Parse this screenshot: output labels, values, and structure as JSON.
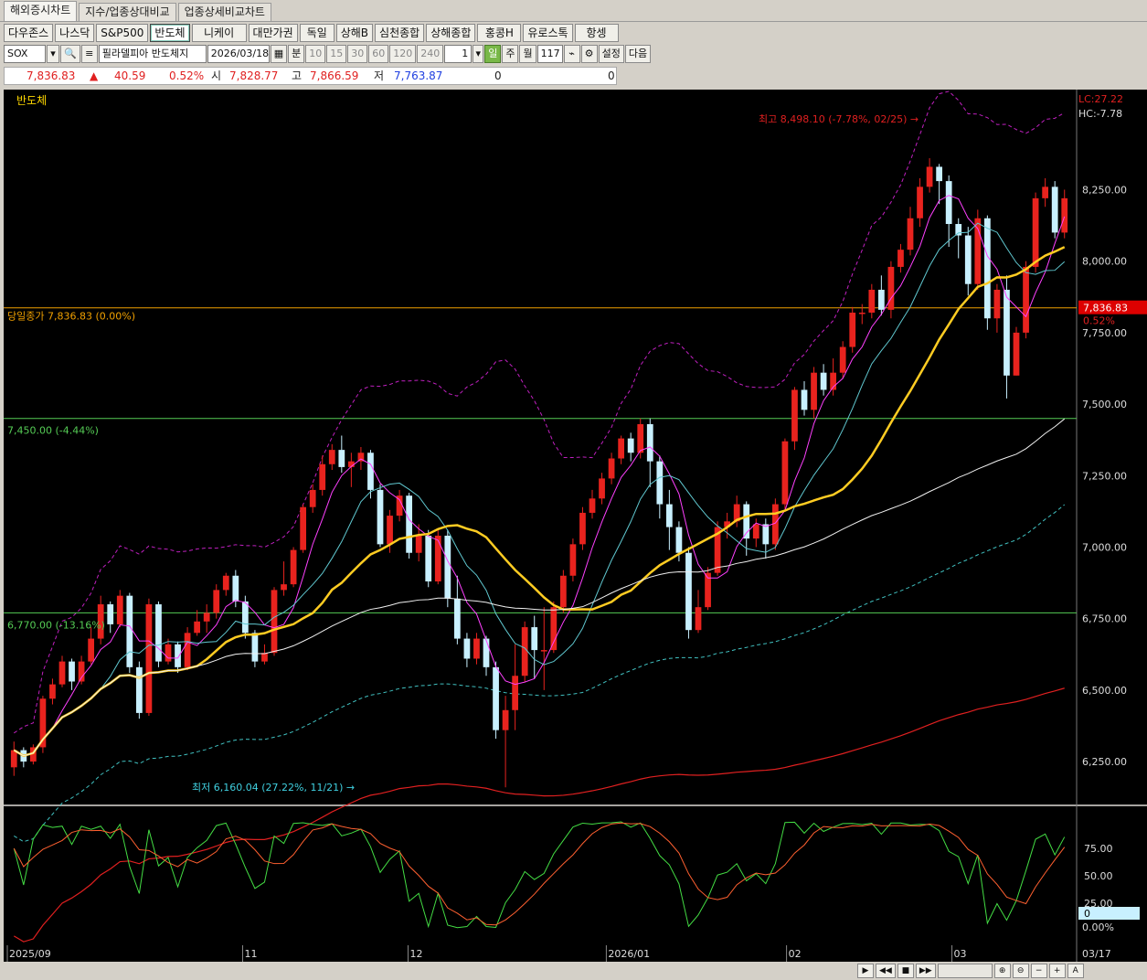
{
  "tabs": [
    "해외증시차트",
    "지수/업종상대비교",
    "업종상세비교차트"
  ],
  "markets": [
    "다우존스",
    "나스닥",
    "S&P500",
    "반도체",
    "니케이",
    "대만가권",
    "독일",
    "상해B",
    "심천종합",
    "상해종합",
    "홍콩H",
    "유로스톡",
    "항셍"
  ],
  "active_market": "반도체",
  "controls": {
    "symbol": "SOX",
    "name_label": "필라델피아 반도체지",
    "date": "2026/03/18",
    "minute_label": "분",
    "intervals": [
      "10",
      "15",
      "30",
      "60",
      "120",
      "240"
    ],
    "count": "1",
    "day": "일",
    "week": "주",
    "month": "월",
    "bars": "117",
    "settings": "설정",
    "next": "다음"
  },
  "price": {
    "last": "7,836.83",
    "change": "40.59",
    "change_pct": "0.52%",
    "open_label": "시",
    "open": "7,828.77",
    "high_label": "고",
    "high": "7,866.59",
    "low_label": "저",
    "low": "7,763.87",
    "vol1": "0",
    "vol2": "0"
  },
  "chart": {
    "title": "반도체",
    "lc_label": "LC:27.22",
    "hc_label": "HC:-7.78",
    "current_price_tag": "7,836.83",
    "current_pct_tag": "0.52%",
    "close_line_label": "당일종가 7,836.83 (0.00%)",
    "hline1_label": "7,450.00 (-4.44%)",
    "hline2_label": "6,770.00 (-13.16%)",
    "high_annotation": "최고 8,498.10 (-7.78%, 02/25)",
    "low_annotation": "최저 6,160.04 (27.22%, 11/21)",
    "y_ticks": [
      "8,250.00",
      "8,000.00",
      "7,750.00",
      "7,500.00",
      "7,250.00",
      "7,000.00",
      "6,750.00",
      "6,500.00",
      "6,250.00"
    ],
    "osc_ticks": [
      "75.00",
      "50.00",
      "25.00"
    ],
    "osc_value": "0",
    "osc_pct": "0.00%",
    "x_labels": [
      "2025/09",
      "11",
      "12",
      "2026/01",
      "02",
      "03"
    ],
    "x_right_label": "03/17",
    "colors": {
      "up": "#e8231e",
      "down": "#c8f0ff",
      "ma5": "#ff40ff",
      "ma10": "#60c8d0",
      "ma20": "#ffcc22",
      "ma60": "#f0f0f0",
      "ma120": "#e02020",
      "envelope": "#c020c0",
      "band": "#40c0c0",
      "hline": "#55cc55",
      "closeline": "#f0a000"
    }
  },
  "chart_data": {
    "type": "candlestick",
    "title": "반도체",
    "ylim": [
      6100,
      8600
    ],
    "y_ticks": [
      6250,
      6500,
      6750,
      7000,
      7250,
      7500,
      7750,
      8000,
      8250
    ],
    "x_labels": [
      "2025/09",
      "11",
      "12",
      "2026/01",
      "02",
      "03",
      "03/17"
    ],
    "high": {
      "value": 8498.1,
      "date": "02/25"
    },
    "low": {
      "value": 6160.04,
      "date": "11/21"
    },
    "reference_lines": [
      7836.83,
      7450.0,
      6770.0
    ],
    "candles": [
      [
        6230,
        6290,
        6200,
        6320
      ],
      [
        6290,
        6250,
        6230,
        6300
      ],
      [
        6250,
        6300,
        6240,
        6310
      ],
      [
        6300,
        6470,
        6280,
        6480
      ],
      [
        6470,
        6520,
        6450,
        6540
      ],
      [
        6520,
        6600,
        6510,
        6620
      ],
      [
        6600,
        6530,
        6500,
        6610
      ],
      [
        6530,
        6600,
        6520,
        6620
      ],
      [
        6600,
        6680,
        6590,
        6720
      ],
      [
        6680,
        6800,
        6660,
        6830
      ],
      [
        6800,
        6730,
        6700,
        6810
      ],
      [
        6730,
        6830,
        6720,
        6850
      ],
      [
        6830,
        6580,
        6560,
        6840
      ],
      [
        6580,
        6420,
        6400,
        6600
      ],
      [
        6420,
        6800,
        6410,
        6820
      ],
      [
        6800,
        6600,
        6580,
        6810
      ],
      [
        6600,
        6660,
        6590,
        6680
      ],
      [
        6660,
        6580,
        6560,
        6670
      ],
      [
        6580,
        6700,
        6570,
        6720
      ],
      [
        6700,
        6740,
        6690,
        6780
      ],
      [
        6740,
        6770,
        6700,
        6800
      ],
      [
        6770,
        6850,
        6750,
        6870
      ],
      [
        6850,
        6900,
        6830,
        6910
      ],
      [
        6900,
        6810,
        6790,
        6920
      ],
      [
        6810,
        6700,
        6680,
        6830
      ],
      [
        6700,
        6600,
        6580,
        6710
      ],
      [
        6600,
        6630,
        6590,
        6660
      ],
      [
        6630,
        6850,
        6620,
        6860
      ],
      [
        6850,
        6870,
        6830,
        6950
      ],
      [
        6870,
        6990,
        6860,
        7000
      ],
      [
        6990,
        7140,
        6980,
        7150
      ],
      [
        7140,
        7200,
        7120,
        7220
      ],
      [
        7200,
        7290,
        7180,
        7320
      ],
      [
        7290,
        7340,
        7270,
        7360
      ],
      [
        7340,
        7280,
        7260,
        7390
      ],
      [
        7280,
        7300,
        7210,
        7330
      ],
      [
        7300,
        7330,
        7270,
        7350
      ],
      [
        7330,
        7200,
        7170,
        7340
      ],
      [
        7200,
        7010,
        7000,
        7220
      ],
      [
        7010,
        7110,
        6980,
        7130
      ],
      [
        7110,
        7180,
        7090,
        7200
      ],
      [
        7180,
        6980,
        6960,
        7190
      ],
      [
        6980,
        7040,
        6950,
        7080
      ],
      [
        7040,
        6880,
        6860,
        7060
      ],
      [
        6880,
        7040,
        6870,
        7060
      ],
      [
        7040,
        6820,
        6790,
        7060
      ],
      [
        6820,
        6680,
        6660,
        6900
      ],
      [
        6680,
        6610,
        6580,
        6700
      ],
      [
        6610,
        6680,
        6590,
        6700
      ],
      [
        6680,
        6580,
        6550,
        6690
      ],
      [
        6580,
        6360,
        6330,
        6600
      ],
      [
        6360,
        6430,
        6160,
        6480
      ],
      [
        6430,
        6550,
        6360,
        6660
      ],
      [
        6550,
        6720,
        6530,
        6740
      ],
      [
        6720,
        6640,
        6540,
        6760
      ],
      [
        6640,
        6640,
        6500,
        6790
      ],
      [
        6640,
        6790,
        6630,
        6810
      ],
      [
        6790,
        6900,
        6770,
        6920
      ],
      [
        6900,
        7010,
        6880,
        7030
      ],
      [
        7010,
        7120,
        6990,
        7140
      ],
      [
        7120,
        7170,
        7100,
        7200
      ],
      [
        7170,
        7240,
        7150,
        7260
      ],
      [
        7240,
        7310,
        7220,
        7330
      ],
      [
        7310,
        7380,
        7290,
        7390
      ],
      [
        7380,
        7330,
        7300,
        7400
      ],
      [
        7330,
        7430,
        7310,
        7450
      ],
      [
        7430,
        7300,
        7210,
        7450
      ],
      [
        7300,
        7150,
        7100,
        7320
      ],
      [
        7150,
        7070,
        6990,
        7200
      ],
      [
        7070,
        6980,
        6950,
        7090
      ],
      [
        6980,
        6710,
        6680,
        7000
      ],
      [
        6710,
        6790,
        6700,
        6850
      ],
      [
        6790,
        6910,
        6780,
        6930
      ],
      [
        6910,
        7070,
        6900,
        7090
      ],
      [
        7070,
        7090,
        7030,
        7120
      ],
      [
        7090,
        7150,
        7070,
        7180
      ],
      [
        7150,
        7030,
        6970,
        7160
      ],
      [
        7030,
        7080,
        7000,
        7100
      ],
      [
        7080,
        7010,
        6960,
        7100
      ],
      [
        7010,
        7150,
        6990,
        7170
      ],
      [
        7150,
        7370,
        7130,
        7380
      ],
      [
        7370,
        7550,
        7340,
        7560
      ],
      [
        7550,
        7480,
        7460,
        7580
      ],
      [
        7480,
        7610,
        7450,
        7630
      ],
      [
        7610,
        7550,
        7530,
        7640
      ],
      [
        7550,
        7610,
        7530,
        7660
      ],
      [
        7610,
        7700,
        7590,
        7720
      ],
      [
        7700,
        7820,
        7680,
        7840
      ],
      [
        7820,
        7820,
        7780,
        7850
      ],
      [
        7820,
        7900,
        7800,
        7920
      ],
      [
        7900,
        7830,
        7810,
        7950
      ],
      [
        7830,
        7980,
        7800,
        8000
      ],
      [
        7980,
        8040,
        7960,
        8060
      ],
      [
        8040,
        8150,
        8020,
        8190
      ],
      [
        8150,
        8260,
        8120,
        8290
      ],
      [
        8260,
        8330,
        8240,
        8360
      ],
      [
        8330,
        8280,
        8200,
        8340
      ],
      [
        8280,
        8130,
        8050,
        8300
      ],
      [
        8130,
        8090,
        8010,
        8150
      ],
      [
        8090,
        7920,
        7880,
        8120
      ],
      [
        7920,
        8150,
        7900,
        8180
      ],
      [
        8150,
        7800,
        7760,
        8160
      ],
      [
        7800,
        7900,
        7750,
        7920
      ],
      [
        7900,
        7600,
        7520,
        7950
      ],
      [
        7600,
        7750,
        7600,
        7770
      ],
      [
        7750,
        7980,
        7730,
        8000
      ],
      [
        7980,
        8220,
        7960,
        8240
      ],
      [
        8220,
        8260,
        8190,
        8290
      ],
      [
        8260,
        8100,
        8080,
        8280
      ],
      [
        8100,
        8220,
        8080,
        8250
      ]
    ]
  }
}
